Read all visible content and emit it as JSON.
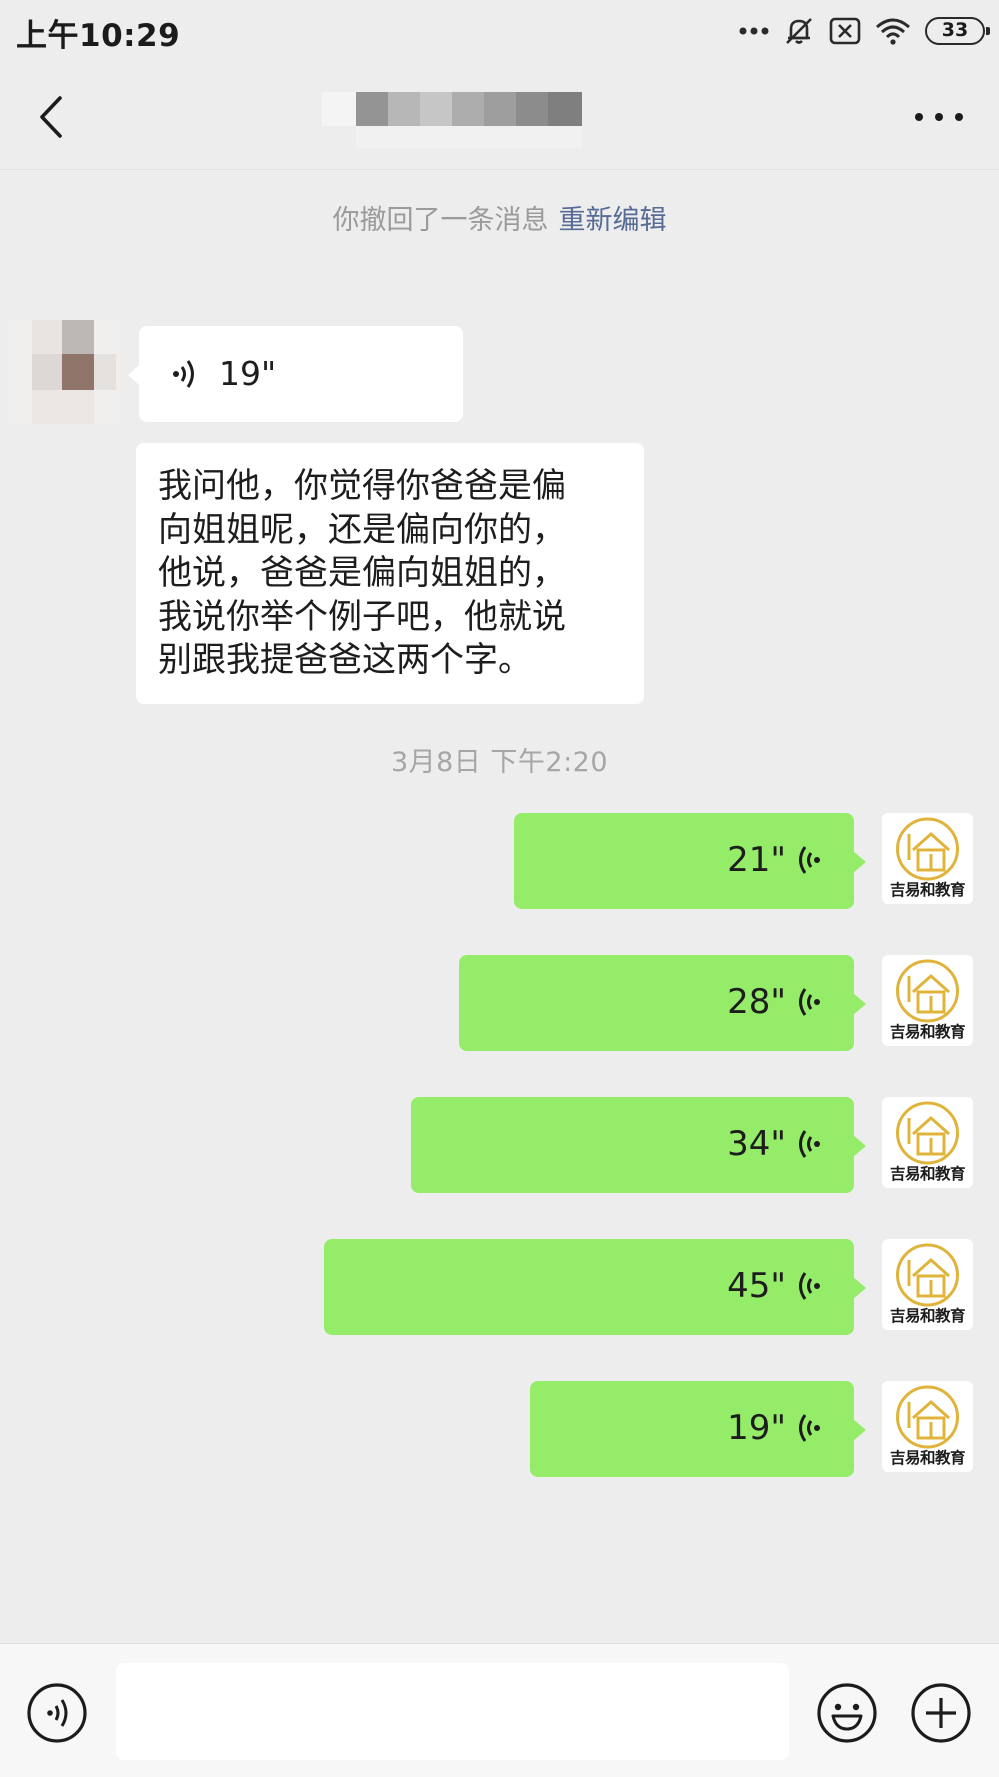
{
  "status_bar": {
    "time": "上午10:29",
    "battery_level": "33",
    "icons": [
      "more-dots-icon",
      "mute-bell-icon",
      "sim-x-icon",
      "wifi-icon",
      "battery-icon"
    ]
  },
  "nav_bar": {
    "back_icon": "chevron-left-icon",
    "title": "",
    "title_pixelated": true,
    "more_icon": "ellipsis-icon"
  },
  "chat": {
    "system_notice": {
      "text": "你撤回了一条消息",
      "link": "重新编辑"
    },
    "incoming": {
      "avatar_pixelated": true,
      "voice_duration": "19\"",
      "text_lines": [
        "我问他，你觉得你爸爸是偏",
        "向姐姐呢，还是偏向你的，",
        "他说，爸爸是偏向姐姐的，",
        "我说你举个例子吧，他就说",
        "别跟我提爸爸这两个字。"
      ]
    },
    "timestamp": "3月8日  下午2:20",
    "outgoing": {
      "avatar_brand": "吉易和教育",
      "voice_messages": [
        {
          "duration": "21\""
        },
        {
          "duration": "28\""
        },
        {
          "duration": "34\""
        },
        {
          "duration": "45\""
        },
        {
          "duration": "19\""
        }
      ]
    }
  },
  "input_bar": {
    "voice_toggle_icon": "voice-mode-icon",
    "input_value": "",
    "emoji_icon": "emoji-icon",
    "plus_icon": "plus-icon"
  },
  "colors": {
    "background": "#ededed",
    "incoming_bubble": "#ffffff",
    "outgoing_bubble": "#95ec69",
    "link": "#576b95",
    "avatar_ring": "#e0b43a"
  }
}
